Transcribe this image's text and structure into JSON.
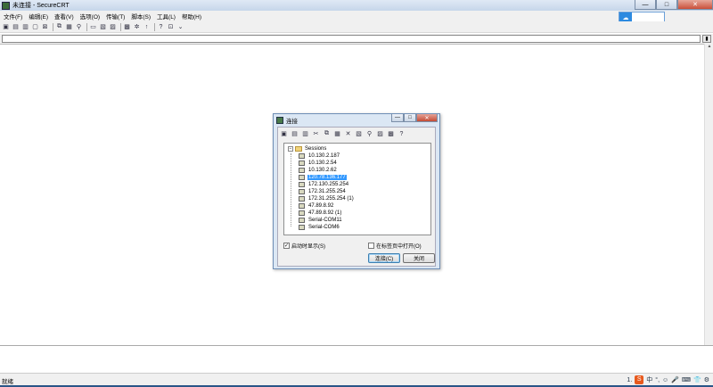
{
  "window": {
    "title": "未连接 - SecureCRT",
    "minimize": "—",
    "maximize": "□",
    "close": "✕"
  },
  "menu": [
    "文件(F)",
    "编辑(E)",
    "查看(V)",
    "选项(O)",
    "传输(T)",
    "脚本(S)",
    "工具(L)",
    "帮助(H)"
  ],
  "status": {
    "left_text": "就绪",
    "tray": {
      "page": "1.",
      "ime_icon": "S",
      "ime_lang": "中",
      "items": [
        "°,",
        "☺",
        "🎤",
        "⌨",
        "👕",
        "⚙"
      ]
    }
  },
  "dialog": {
    "title": "连接",
    "root_label": "Sessions",
    "sessions": [
      {
        "label": "10.130.2.187",
        "selected": false
      },
      {
        "label": "10.130.2.54",
        "selected": false
      },
      {
        "label": "10.130.2.62",
        "selected": false
      },
      {
        "label": "120.78.136.177",
        "selected": true
      },
      {
        "label": "172.130.255.254",
        "selected": false
      },
      {
        "label": "172.31.255.254",
        "selected": false
      },
      {
        "label": "172.31.255.254 (1)",
        "selected": false
      },
      {
        "label": "47.89.8.92",
        "selected": false
      },
      {
        "label": "47.89.8.92 (1)",
        "selected": false
      },
      {
        "label": "Serial-COM11",
        "selected": false
      },
      {
        "label": "Serial-COM6",
        "selected": false
      }
    ],
    "checkbox_startup": {
      "label": "启动时显示(S)",
      "checked": true
    },
    "checkbox_tab": {
      "label": "在标签页中打开(O)",
      "checked": false
    },
    "connect_label": "连接(C)",
    "close_label": "关闭"
  }
}
